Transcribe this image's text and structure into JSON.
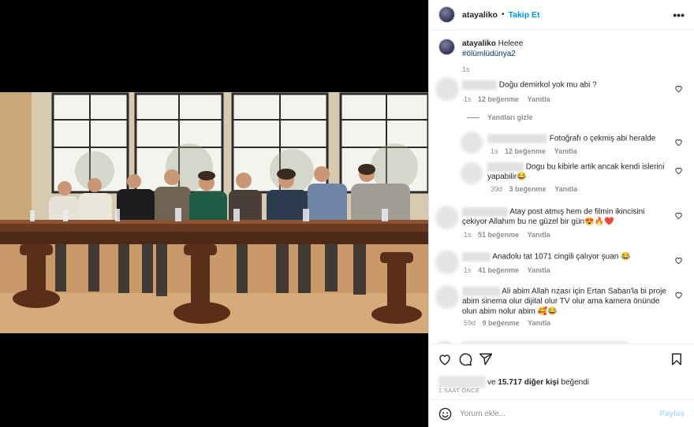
{
  "post": {
    "username": "atayaliko",
    "follow_label": "Takip Et",
    "more_label": "•••",
    "caption_user": "atayaliko",
    "caption_text": "Heleee",
    "caption_hashtag": "#ölümlüdünya2",
    "caption_time": "1s"
  },
  "comments": [
    {
      "text": "Doğu demirkol yok mu abi ?",
      "time": "1s",
      "likes": "12 beğenme",
      "reply": "Yanıtla"
    },
    {
      "text": "Fotoğrafı o çekmiş abi heralde",
      "time": "1s",
      "likes": "12 beğenme",
      "reply": "Yanıtla"
    },
    {
      "text": "Dogu bu kibirle artik ancak kendi islerini yapabilir😂",
      "time": "39d",
      "likes": "3 beğenme",
      "reply": "Yanıtla"
    },
    {
      "text": "Atay post atmış hem de filmin ikincisini çekiyor Allahım bu ne güzel bir gün😍🔥❤️",
      "time": "1s",
      "likes": "51 beğenme",
      "reply": "Yanıtla"
    },
    {
      "text": "Anadolu tat 1071 cingili çalıyor şuan 😂",
      "time": "1s",
      "likes": "41 beğenme",
      "reply": "Yanıtla"
    },
    {
      "text": "Ali abim Allah rızası için Ertan Saban'la bi proje abim sinema olur dijital olur TV olur ama kamera önünde olun abim nolur abim 🥰😂",
      "time": "59d",
      "likes": "9 beğenme",
      "reply": "Yanıtla"
    }
  ],
  "hide_replies_label": "Yanıtları gizle",
  "likes_summary": {
    "prefix": "ve",
    "count": "15.717 diğer kişi",
    "suffix": "beğendi"
  },
  "time_ago": "1 SAAT ÖNCE",
  "comment_input": {
    "placeholder": "Yorum ekle...",
    "post_label": "Paylaş"
  },
  "icons": {
    "like": "heart-icon",
    "comment": "comment-icon",
    "share": "share-icon",
    "save": "bookmark-icon",
    "emoji": "emoji-icon"
  },
  "colors": {
    "accent": "#0095f6",
    "hashtag": "#00376b",
    "muted": "#8e8e8e"
  }
}
